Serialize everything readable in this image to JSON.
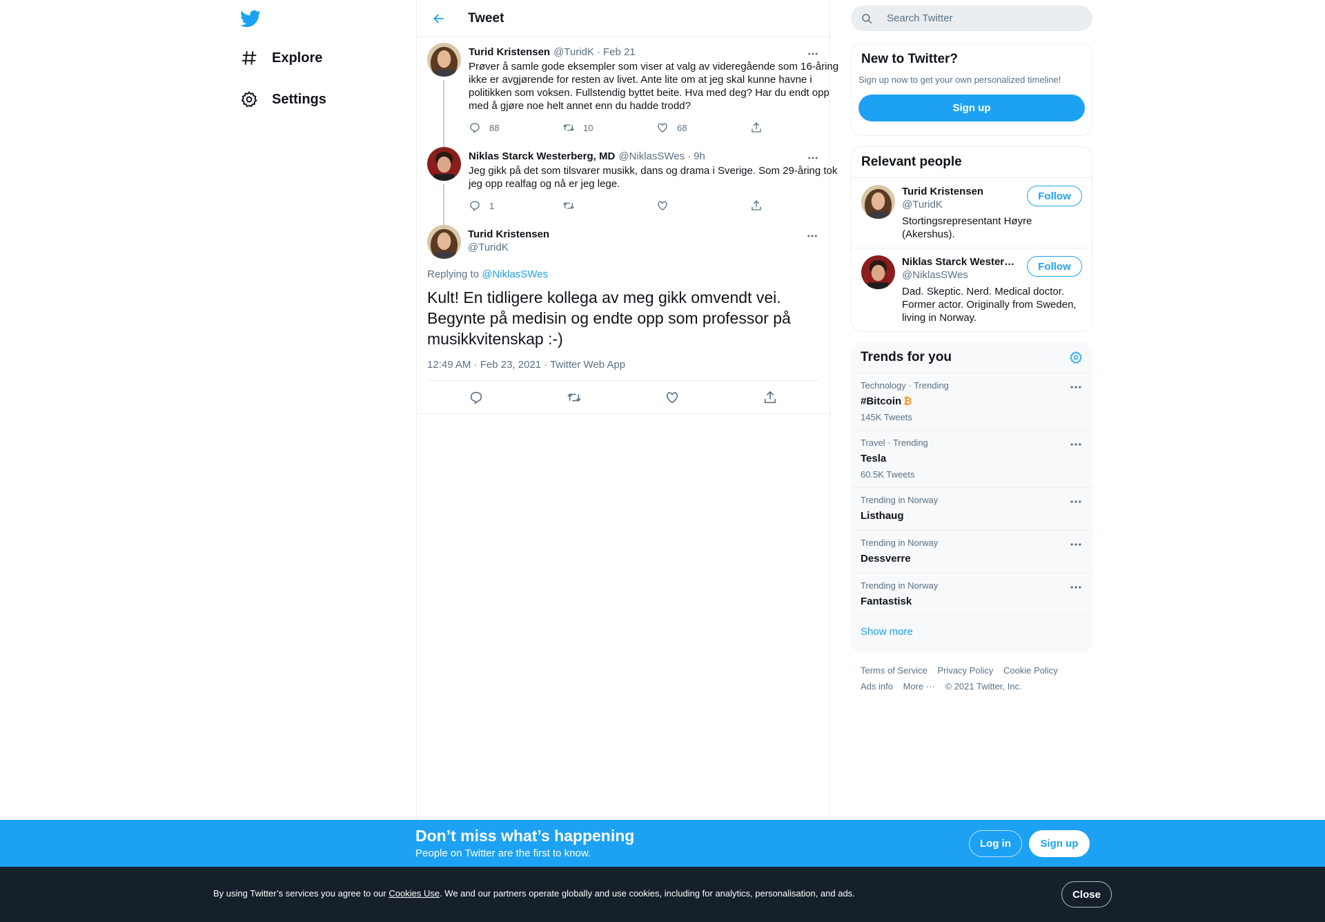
{
  "nav": {
    "logo": "twitter-logo",
    "items": [
      {
        "label": "Explore",
        "icon": "hashtag-icon"
      },
      {
        "label": "Settings",
        "icon": "gear-icon"
      }
    ]
  },
  "main": {
    "header_title": "Tweet",
    "tweets": [
      {
        "name": "Turid Kristensen",
        "handle": "@TuridK",
        "time": "Feb 21",
        "text": "Prøver å samle gode eksempler som viser at valg av videregående som 16-åring ikke er avgjørende for resten av livet. Ante lite om at jeg skal kunne havne i politikken som voksen. Fullstendig byttet beite. Hva med deg? Har du endt opp med å gjøre noe helt annet enn du hadde trodd?",
        "replies": "88",
        "retweets": "10",
        "likes": "68"
      },
      {
        "name": "Niklas Starck Westerberg, MD",
        "handle": "@NiklasSWes",
        "time": "9h",
        "text": "Jeg gikk på det som tilsvarer musikk, dans og drama i Sverige. Som 29-åring tok jeg opp realfag og nå er jeg lege.",
        "replies": "1",
        "retweets": "",
        "likes": ""
      }
    ],
    "focus": {
      "name": "Turid Kristensen",
      "handle": "@TuridK",
      "replying_prefix": "Replying to ",
      "replying_handle": "@NiklasSWes",
      "text": "Kult! En tidligere kollega av meg gikk omvendt vei. Begynte på medisin og endte opp som professor på musikkvitenskap :-)",
      "meta": "12:49 AM · Feb 23, 2021 · Twitter Web App"
    }
  },
  "right": {
    "search_placeholder": "Search Twitter",
    "new_card": {
      "title": "New to Twitter?",
      "subtitle": "Sign up now to get your own personalized timeline!",
      "button": "Sign up"
    },
    "relevant": {
      "title": "Relevant people",
      "people": [
        {
          "name": "Turid Kristensen",
          "handle": "@TuridK",
          "bio": "Stortingsrepresentant Høyre (Akershus).",
          "button": "Follow"
        },
        {
          "name": "Niklas Starck Westerberg, MD",
          "handle": "@NiklasSWes",
          "bio": "Dad. Skeptic. Nerd. Medical doctor. Former actor. Originally from Sweden, living in Norway.",
          "button": "Follow"
        }
      ]
    },
    "trends": {
      "title": "Trends for you",
      "items": [
        {
          "context": "Technology · Trending",
          "name": "#Bitcoin",
          "emoji": "₿",
          "count": "145K Tweets"
        },
        {
          "context": "Travel · Trending",
          "name": "Tesla",
          "emoji": "",
          "count": "60.5K Tweets"
        },
        {
          "context": "Trending in Norway",
          "name": "Listhaug",
          "emoji": "",
          "count": ""
        },
        {
          "context": "Trending in Norway",
          "name": "Dessverre",
          "emoji": "",
          "count": ""
        },
        {
          "context": "Trending in Norway",
          "name": "Fantastisk",
          "emoji": "",
          "count": ""
        }
      ],
      "show_more": "Show more"
    },
    "footer": {
      "links": [
        "Terms of Service",
        "Privacy Policy",
        "Cookie Policy",
        "Ads info",
        "More ···"
      ],
      "copyright": "© 2021 Twitter, Inc."
    }
  },
  "banner": {
    "title": "Don’t miss what’s happening",
    "subtitle": "People on Twitter are the first to know.",
    "login": "Log in",
    "signup": "Sign up"
  },
  "cookie": {
    "prefix": "By using Twitter’s services you agree to our ",
    "link": "Cookies Use",
    "suffix": ". We and our partners operate globally and use cookies, including for analytics, personalisation, and ads.",
    "close": "Close"
  },
  "colors": {
    "accent": "#1da1f2",
    "text": "#0f1419",
    "muted": "#5b7083",
    "cookie_bg": "#15202b"
  }
}
